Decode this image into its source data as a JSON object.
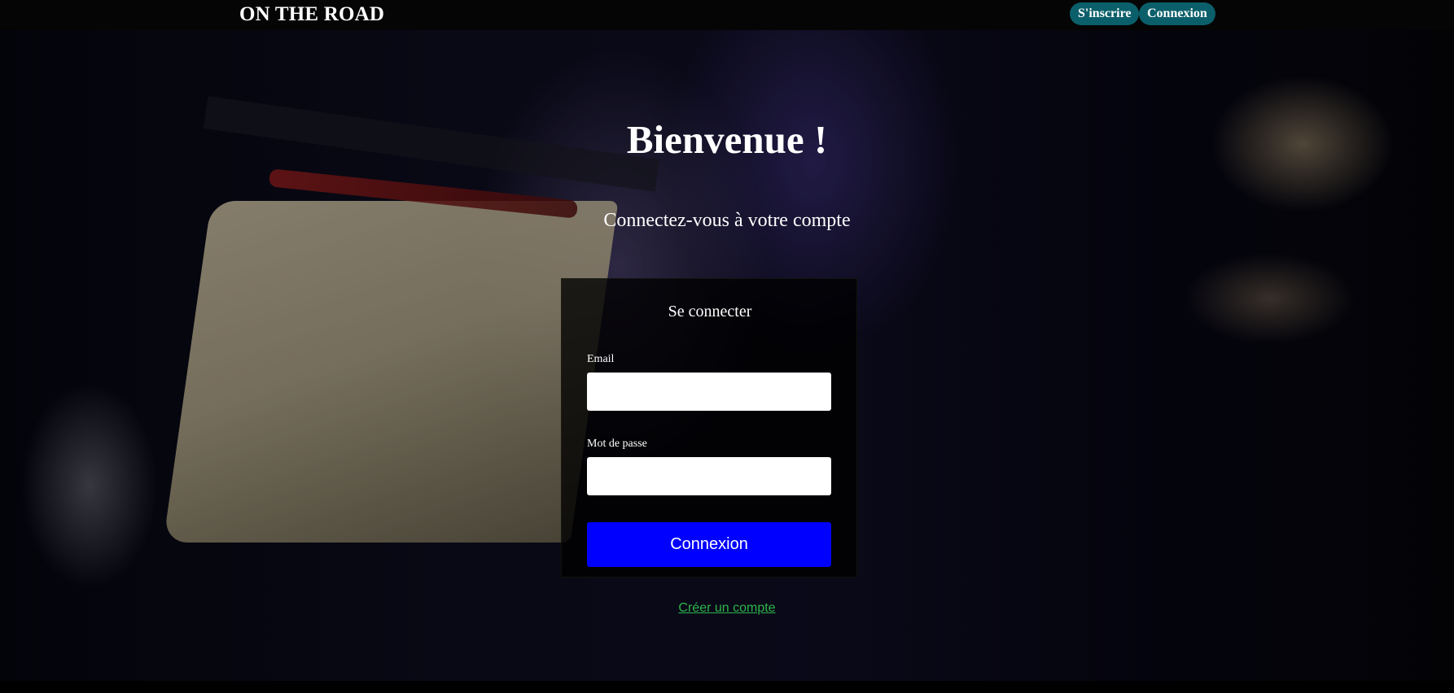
{
  "header": {
    "brand": "ON THE ROAD",
    "nav": {
      "signup_label": "S'inscrire",
      "login_label": "Connexion"
    }
  },
  "hero": {
    "title": "Bienvenue !",
    "subtitle": "Connectez-vous à votre compte"
  },
  "login_form": {
    "title": "Se connecter",
    "email_label": "Email",
    "email_value": "",
    "password_label": "Mot de passe",
    "password_value": "",
    "submit_label": "Connexion"
  },
  "footer_link": {
    "create_account": "Créer un compte"
  },
  "colors": {
    "nav_button": "#0b5f6a",
    "submit_button": "#0000ff",
    "link": "#2db54a"
  }
}
